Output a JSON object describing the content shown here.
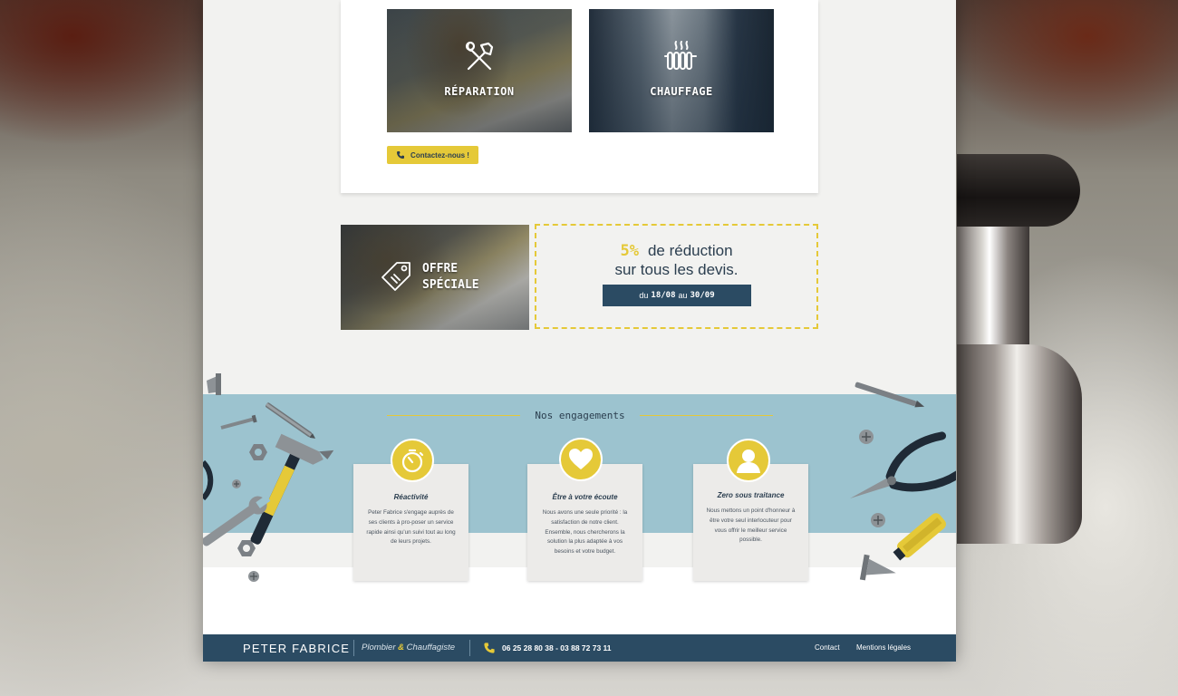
{
  "colors": {
    "accent": "#e5c938",
    "navy": "#2b4b63",
    "band": "#9cc3cf"
  },
  "services": [
    {
      "label": "RÉPARATION",
      "icon": "hammer-wrench-icon"
    },
    {
      "label": "CHAUFFAGE",
      "icon": "radiator-icon"
    }
  ],
  "contact_button": {
    "label": "Contactez-nous !",
    "icon": "phone-icon"
  },
  "offer": {
    "image_label_line1": "OFFRE",
    "image_label_line2": "SPÉCIALE",
    "icon": "price-tag-icon",
    "percent": "5%",
    "line1_rest": "de réduction",
    "line2": "sur tous les devis.",
    "dates_prefix": "du",
    "date_from": "18/08",
    "dates_mid": "au",
    "date_to": "30/09"
  },
  "engagements": {
    "title": "Nos engagements",
    "cards": [
      {
        "title": "Réactivité",
        "icon": "stopwatch-icon",
        "text": "Peter Fabrice s'engage auprès de ses clients à pro-poser un service rapide ainsi qu'un suivi tout au long de leurs projets."
      },
      {
        "title": "Être à votre écoute",
        "icon": "heart-icon",
        "text": "Nous avons une seule priorité : la satisfaction de notre client. Ensemble, nous chercherons la solution la plus adaptée à vos besoins et votre budget."
      },
      {
        "title": "Zero sous traitance",
        "icon": "user-icon",
        "text": "Nous mettons un point d'honneur à être votre seul interlocuteur pour vous offrir le meilleur service possible."
      }
    ]
  },
  "footer": {
    "brand": "PETER FABRICE",
    "trade_part1": "Plombier",
    "trade_amp": "&",
    "trade_part2": "Chauffagiste",
    "phones": "06 25 28 80 38  -  03 88 72 73 11",
    "links": [
      "Contact",
      "Mentions légales"
    ]
  }
}
